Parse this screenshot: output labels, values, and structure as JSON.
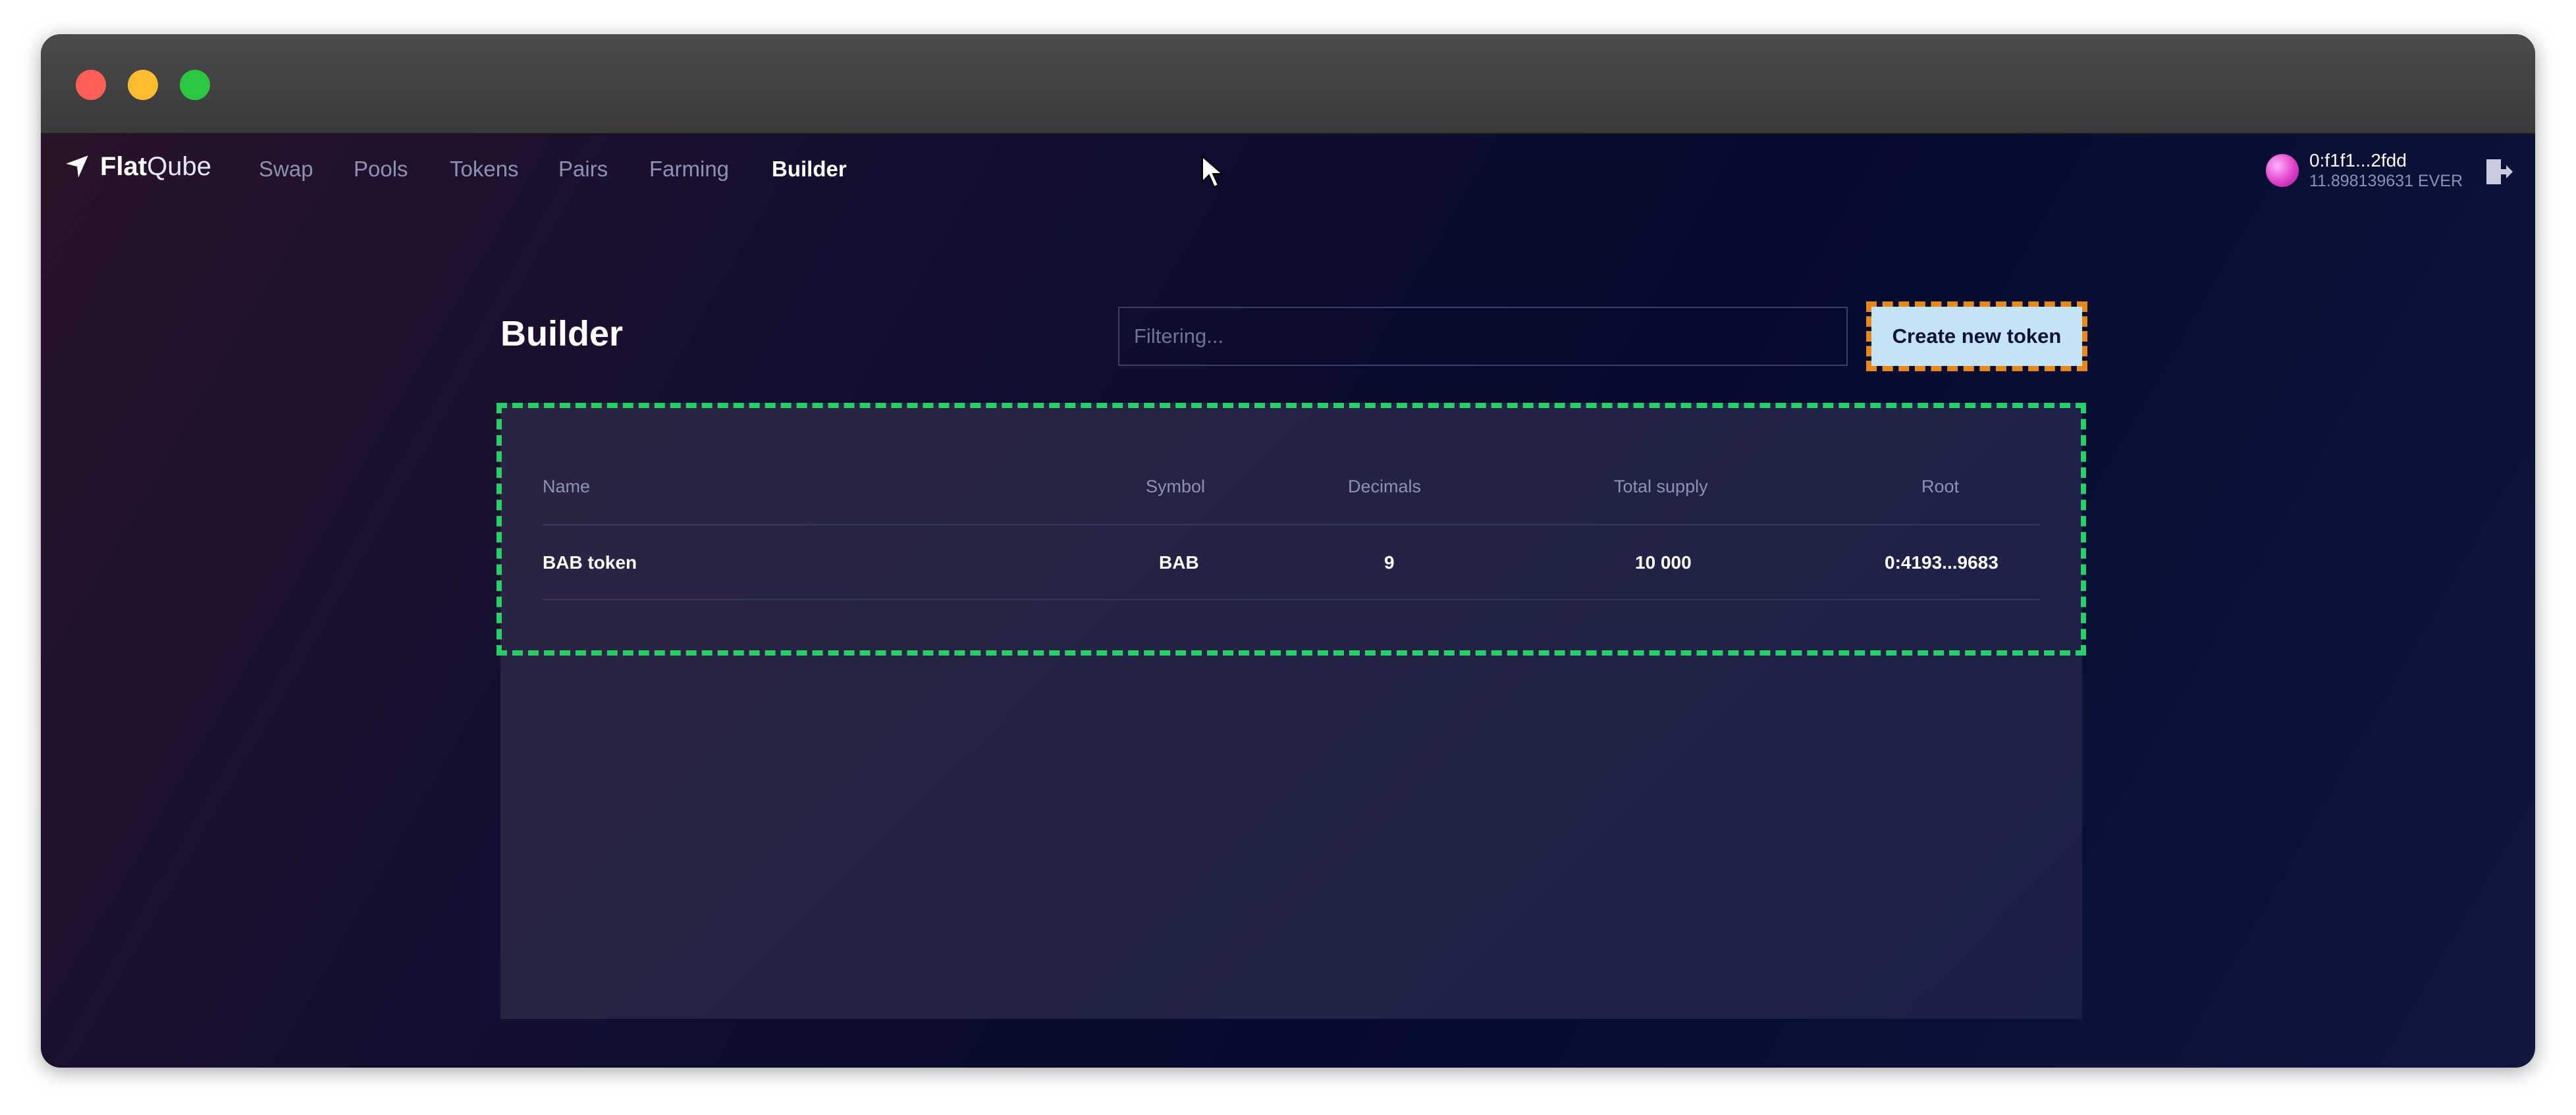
{
  "app": {
    "logo_flat": "Flat",
    "logo_qube": "Qube"
  },
  "nav": {
    "items": [
      {
        "label": "Swap"
      },
      {
        "label": "Pools"
      },
      {
        "label": "Tokens"
      },
      {
        "label": "Pairs"
      },
      {
        "label": "Farming"
      },
      {
        "label": "Builder",
        "active": true
      }
    ]
  },
  "wallet": {
    "address": "0:f1f1...2fdd",
    "balance": "11.898139631 EVER"
  },
  "page": {
    "title": "Builder",
    "filter_placeholder": "Filtering...",
    "create_button": "Create new token"
  },
  "table": {
    "columns": [
      "Name",
      "Symbol",
      "Decimals",
      "Total supply",
      "Root"
    ],
    "rows": [
      [
        "BAB token",
        "BAB",
        "9",
        "10 000",
        "0:4193...9683"
      ]
    ]
  },
  "colors": {
    "accent_button": "#c3e4f5",
    "highlight_orange": "#e8881a",
    "highlight_green": "#27d065"
  }
}
